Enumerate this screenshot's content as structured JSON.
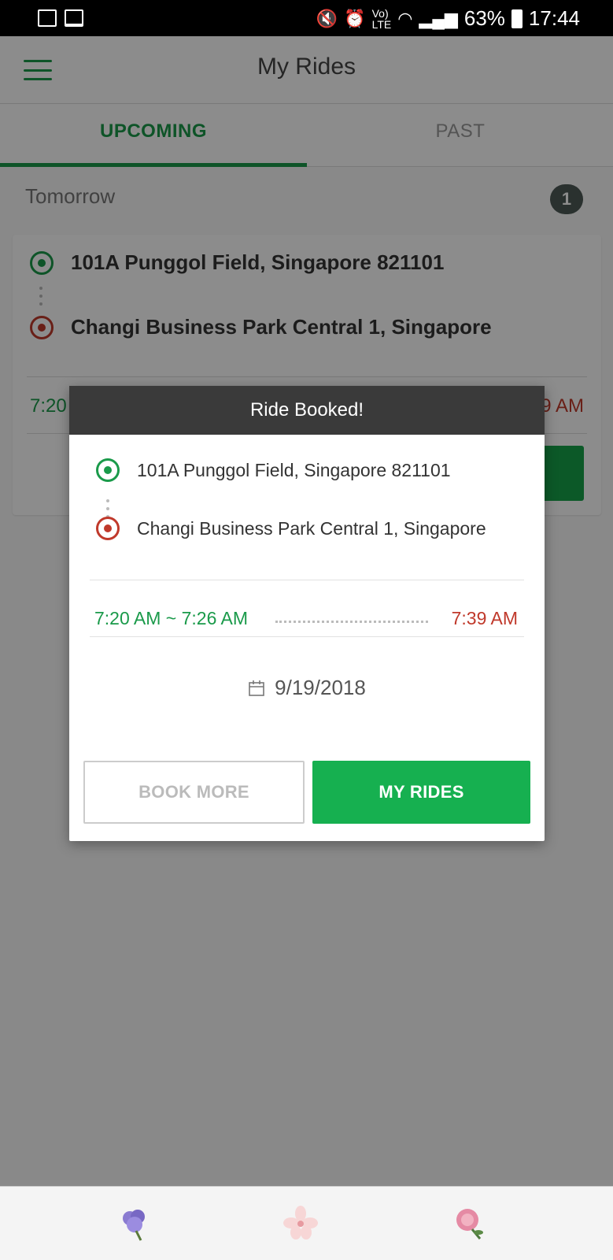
{
  "status_bar": {
    "battery": "63%",
    "time": "17:44"
  },
  "app_bar": {
    "title": "My Rides"
  },
  "tabs": [
    {
      "label": "UPCOMING",
      "active": true
    },
    {
      "label": "PAST",
      "active": false
    }
  ],
  "section": {
    "label": "Tomorrow",
    "count": "1"
  },
  "ride_card": {
    "pickup": "101A Punggol Field, Singapore 821101",
    "dropoff": "Changi Business Park Central 1, Singapore",
    "time_start": "7:20",
    "time_end": "9 AM"
  },
  "dialog": {
    "title": "Ride Booked!",
    "pickup": "101A Punggol Field, Singapore 821101",
    "dropoff": "Changi Business Park Central 1, Singapore",
    "pickup_window": "7:20 AM  ~  7:26 AM",
    "arrival_time": "7:39 AM",
    "date": "9/19/2018",
    "book_more_label": "BOOK MORE",
    "my_rides_label": "MY RIDES"
  },
  "colors": {
    "accent_green": "#1a9a4a",
    "button_green": "#16b050",
    "destination_red": "#c0392b",
    "dialog_header": "#3a3a3a"
  },
  "icons": [
    "image-icon",
    "laptop-icon",
    "mute-icon",
    "alarm-icon",
    "volte-icon",
    "wifi-icon",
    "signal-icon",
    "battery-icon",
    "menu-icon",
    "pickup-target-icon",
    "dropoff-target-icon",
    "calendar-icon",
    "flower-purple-icon",
    "flower-white-icon",
    "flower-pink-icon"
  ]
}
